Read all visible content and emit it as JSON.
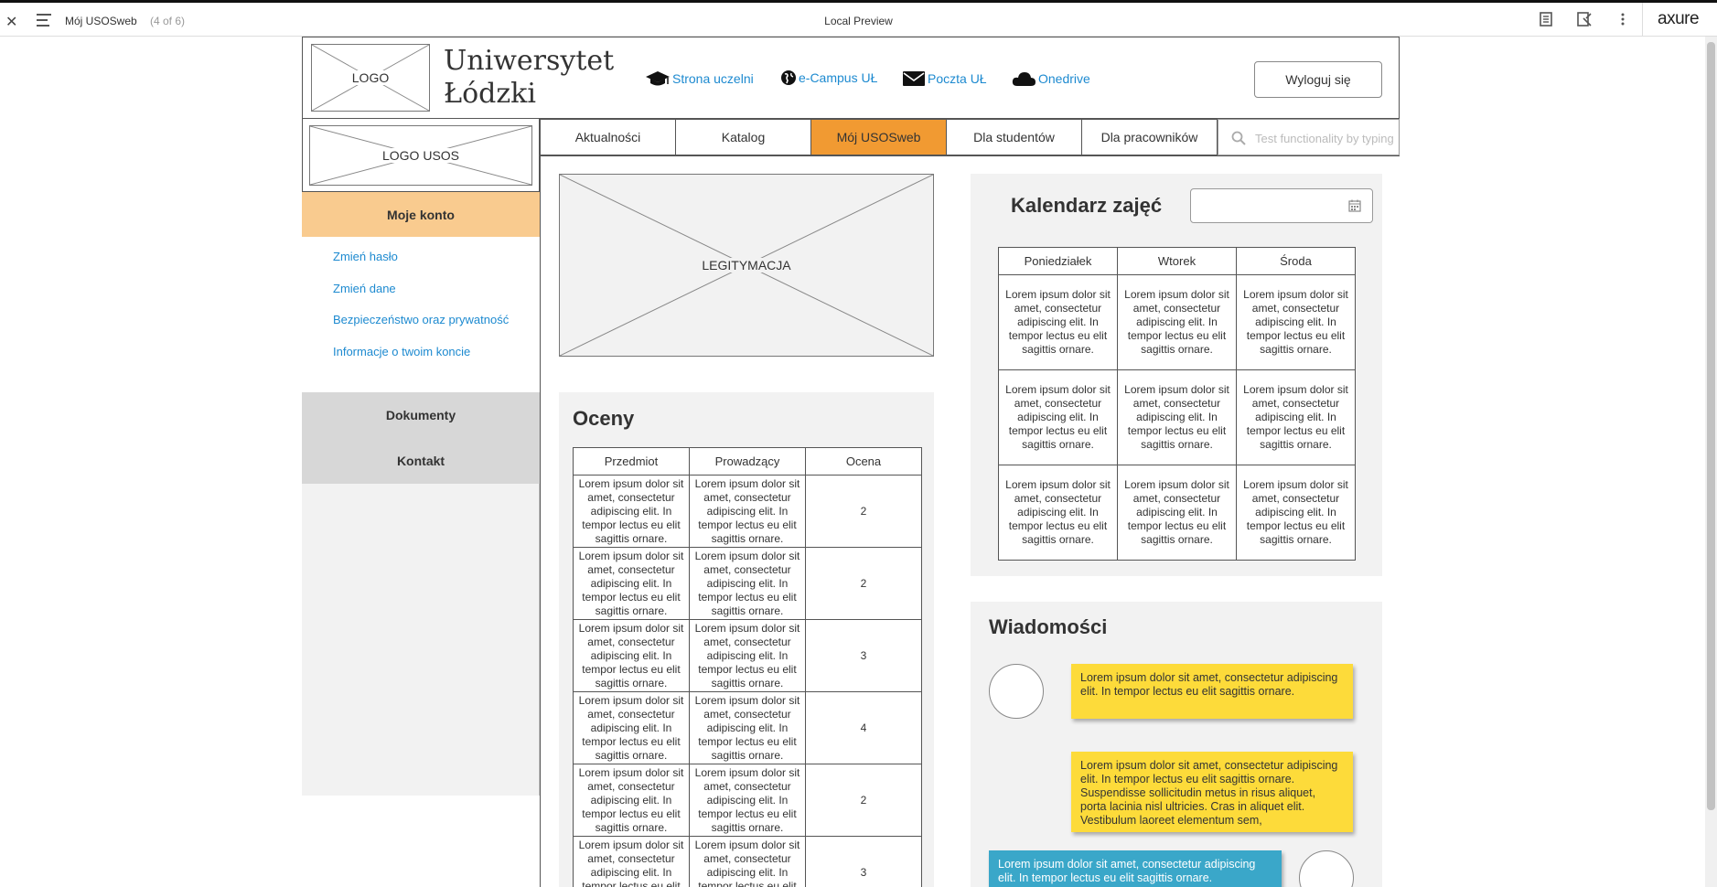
{
  "axure": {
    "page_name": "Mój USOSweb",
    "page_count": "(4 of 6)",
    "center_title": "Local Preview",
    "brand": "axure",
    "icons": [
      "close-icon",
      "menu-icon",
      "notes-icon",
      "inspect-icon",
      "more-icon"
    ]
  },
  "header": {
    "logo_label": "LOGO",
    "university_line1": "Uniwersytet",
    "university_line2": "Łódzki",
    "links": [
      {
        "label": "Strona uczelni",
        "icon": "graduation-cap-icon"
      },
      {
        "label": "e-Campus UŁ",
        "icon": "globe-icon"
      },
      {
        "label": "Poczta UŁ",
        "icon": "envelope-icon"
      },
      {
        "label": "Onedrive",
        "icon": "cloud-icon"
      }
    ],
    "logout_label": "Wyloguj się"
  },
  "sidebar": {
    "logo_usos_label": "LOGO USOS",
    "active_section": "Moje konto",
    "links": [
      "Zmień hasło",
      "Zmień dane",
      "Bezpieczeństwo oraz prywatność",
      "Informacje o twoim koncie"
    ],
    "sections": [
      "Dokumenty",
      "Kontakt"
    ]
  },
  "nav": {
    "tabs": [
      "Aktualności",
      "Katalog",
      "Mój USOSweb",
      "Dla studentów",
      "Dla pracowników"
    ],
    "active_tab": "Mój USOSweb",
    "search_placeholder": "Test functionality by typing"
  },
  "legitymacja": {
    "label": "LEGITYMACJA"
  },
  "grades": {
    "title": "Oceny",
    "columns": [
      "Przedmiot",
      "Prowadzący",
      "Ocena"
    ],
    "cell_text": "Lorem ipsum dolor sit amet, consectetur adipiscing elit. In tempor lectus eu elit sagittis ornare.",
    "rows": [
      {
        "przedmiot": "Lorem ipsum dolor sit amet, consectetur adipiscing elit. In tempor lectus eu elit sagittis ornare.",
        "prowadzacy": "Lorem ipsum dolor sit amet, consectetur adipiscing elit. In tempor lectus eu elit sagittis ornare.",
        "ocena": "2"
      },
      {
        "przedmiot": "Lorem ipsum dolor sit amet, consectetur adipiscing elit. In tempor lectus eu elit sagittis ornare.",
        "prowadzacy": "Lorem ipsum dolor sit amet, consectetur adipiscing elit. In tempor lectus eu elit sagittis ornare.",
        "ocena": "2"
      },
      {
        "przedmiot": "Lorem ipsum dolor sit amet, consectetur adipiscing elit. In tempor lectus eu elit sagittis ornare.",
        "prowadzacy": "Lorem ipsum dolor sit amet, consectetur adipiscing elit. In tempor lectus eu elit sagittis ornare.",
        "ocena": "3"
      },
      {
        "przedmiot": "Lorem ipsum dolor sit amet, consectetur adipiscing elit. In tempor lectus eu elit sagittis ornare.",
        "prowadzacy": "Lorem ipsum dolor sit amet, consectetur adipiscing elit. In tempor lectus eu elit sagittis ornare.",
        "ocena": "4"
      },
      {
        "przedmiot": "Lorem ipsum dolor sit amet, consectetur adipiscing elit. In tempor lectus eu elit sagittis ornare.",
        "prowadzacy": "Lorem ipsum dolor sit amet, consectetur adipiscing elit. In tempor lectus eu elit sagittis ornare.",
        "ocena": "2"
      },
      {
        "przedmiot": "Lorem ipsum dolor sit amet, consectetur adipiscing elit. In tempor lectus eu elit sagittis ornare.",
        "prowadzacy": "Lorem ipsum dolor sit amet, consectetur adipiscing elit. In tempor lectus eu elit sagittis ornare.",
        "ocena": "3"
      }
    ]
  },
  "calendar": {
    "title": "Kalendarz zajęć",
    "date_value": "",
    "columns": [
      "Poniedziałek",
      "Wtorek",
      "Środa"
    ],
    "rows": [
      [
        "Lorem ipsum dolor sit amet, consectetur adipiscing elit. In tempor lectus eu elit sagittis ornare.",
        "Lorem ipsum dolor sit amet, consectetur adipiscing elit. In tempor lectus eu elit sagittis ornare.",
        "Lorem ipsum dolor sit amet, consectetur adipiscing elit. In tempor lectus eu elit sagittis ornare."
      ],
      [
        "Lorem ipsum dolor sit amet, consectetur adipiscing elit. In tempor lectus eu elit sagittis ornare.",
        "Lorem ipsum dolor sit amet, consectetur adipiscing elit. In tempor lectus eu elit sagittis ornare.",
        "Lorem ipsum dolor sit amet, consectetur adipiscing elit. In tempor lectus eu elit sagittis ornare."
      ],
      [
        "Lorem ipsum dolor sit amet, consectetur adipiscing elit. In tempor lectus eu elit sagittis ornare.",
        "Lorem ipsum dolor sit amet, consectetur adipiscing elit. In tempor lectus eu elit sagittis ornare.",
        "Lorem ipsum dolor sit amet, consectetur adipiscing elit. In tempor lectus eu elit sagittis ornare."
      ]
    ]
  },
  "messages": {
    "title": "Wiadomości",
    "items": [
      {
        "text": "Lorem ipsum dolor sit amet, consectetur adipiscing elit. In tempor lectus eu elit sagittis ornare.",
        "color": "#fddb3a"
      },
      {
        "text": "Lorem ipsum dolor sit amet, consectetur adipiscing elit. In tempor lectus eu elit sagittis ornare. Suspendisse sollicitudin metus in risus aliquet, porta lacinia nisl ultricies. Cras in aliquet elit. Vestibulum laoreet elementum sem,",
        "color": "#fddb3a"
      },
      {
        "text": "Lorem ipsum dolor sit amet, consectetur adipiscing elit. In tempor lectus eu elit sagittis ornare.",
        "color": "#3aa7c9"
      }
    ]
  },
  "colors": {
    "accent_orange": "#f19a32",
    "sidebar_active": "#f9cb8f",
    "link_blue": "#1d8ad0",
    "message_yellow": "#fddb3a",
    "message_blue": "#3aa7c9"
  }
}
